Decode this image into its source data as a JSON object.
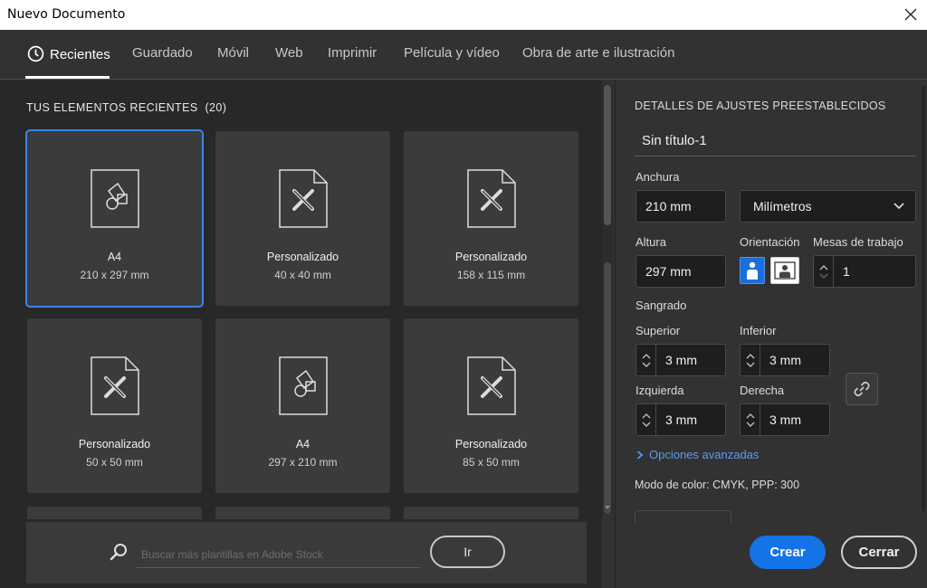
{
  "window": {
    "title": "Nuevo Documento",
    "close_icon": "close-icon"
  },
  "tabs": [
    {
      "label": "Recientes",
      "active": true,
      "icon": "clock-icon"
    },
    {
      "label": "Guardado"
    },
    {
      "label": "Móvil"
    },
    {
      "label": "Web"
    },
    {
      "label": "Imprimir"
    },
    {
      "label": "Película y vídeo"
    },
    {
      "label": "Obra de arte e ilustración"
    }
  ],
  "recent": {
    "title": "TUS ELEMENTOS RECIENTES",
    "count": "(20)",
    "items": [
      {
        "name": "A4",
        "size": "210 x 297 mm",
        "icon": "shapes-document-icon",
        "selected": true
      },
      {
        "name": "Personalizado",
        "size": "40 x 40 mm",
        "icon": "custom-document-icon"
      },
      {
        "name": "Personalizado",
        "size": "158 x 115 mm",
        "icon": "custom-document-icon"
      },
      {
        "name": "Personalizado",
        "size": "50 x 50 mm",
        "icon": "custom-document-icon"
      },
      {
        "name": "A4",
        "size": "297 x 210 mm",
        "icon": "shapes-document-icon"
      },
      {
        "name": "Personalizado",
        "size": "85 x 50 mm",
        "icon": "custom-document-icon"
      }
    ]
  },
  "search": {
    "placeholder": "Buscar más plantillas en Adobe Stock",
    "go_label": "Ir"
  },
  "preset": {
    "title": "DETALLES DE AJUSTES PREESTABLECIDOS",
    "doc_name": "Sin título-1",
    "width_label": "Anchura",
    "width_value": "210 mm",
    "units_value": "Milímetros",
    "height_label": "Altura",
    "height_value": "297 mm",
    "orientation_label": "Orientación",
    "artboards_label": "Mesas de trabajo",
    "artboards_value": "1",
    "bleed_label": "Sangrado",
    "bleed_top_label": "Superior",
    "bleed_top_value": "3 mm",
    "bleed_bottom_label": "Inferior",
    "bleed_bottom_value": "3 mm",
    "bleed_left_label": "Izquierda",
    "bleed_left_value": "3 mm",
    "bleed_right_label": "Derecha",
    "bleed_right_value": "3 mm",
    "advanced_label": "Opciones avanzadas",
    "color_mode": "Modo de color: CMYK, PPP: 300"
  },
  "actions": {
    "create_label": "Crear",
    "close_label": "Cerrar"
  },
  "colors": {
    "accent": "#1473e6",
    "link": "#5b9bf0",
    "selection": "#3a84e6"
  }
}
